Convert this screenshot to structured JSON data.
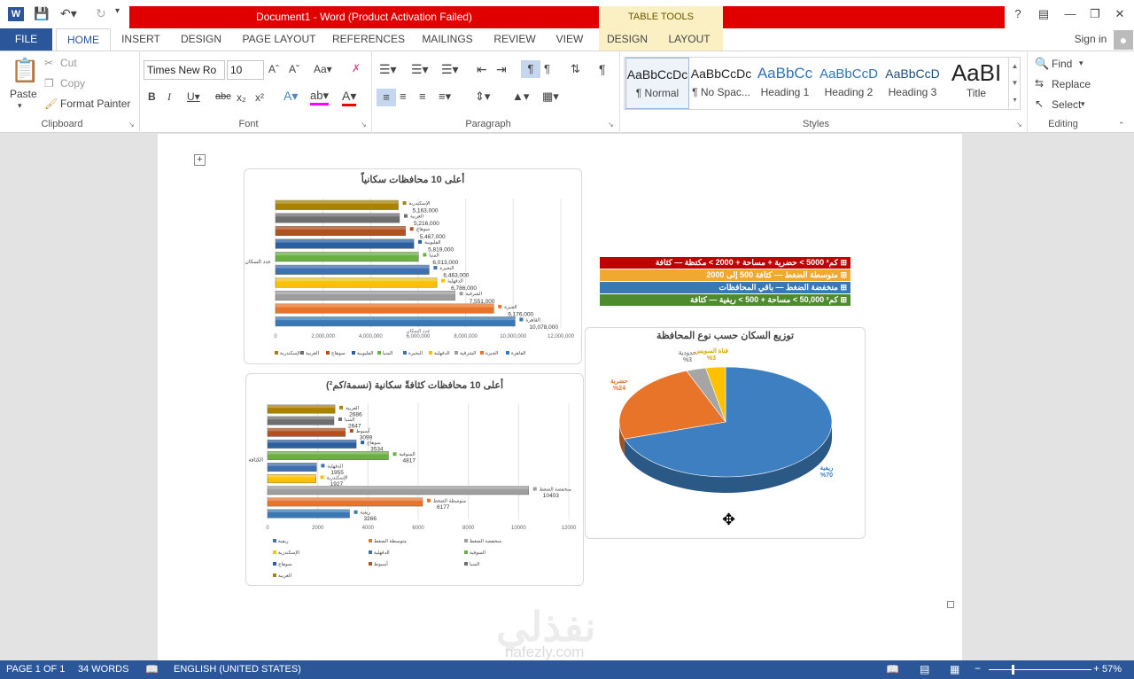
{
  "titlebar": {
    "doc_title": "Document1 -  Word (Product Activation Failed)",
    "table_tools": "TABLE TOOLS",
    "help": "?"
  },
  "tabs": {
    "file": "FILE",
    "home": "HOME",
    "insert": "INSERT",
    "design": "DESIGN",
    "page_layout": "PAGE LAYOUT",
    "references": "REFERENCES",
    "mailings": "MAILINGS",
    "review": "REVIEW",
    "view": "VIEW",
    "tt_design": "DESIGN",
    "tt_layout": "LAYOUT",
    "signin": "Sign in"
  },
  "clipboard": {
    "paste": "Paste",
    "cut": "Cut",
    "copy": "Copy",
    "format_painter": "Format Painter",
    "label": "Clipboard"
  },
  "font": {
    "name": "Times New Ro",
    "size": "10",
    "label": "Font"
  },
  "paragraph": {
    "label": "Paragraph"
  },
  "styles": {
    "items": [
      {
        "sample": "AaBbCcDc",
        "name": "¶ Normal"
      },
      {
        "sample": "AaBbCcDc",
        "name": "¶ No Spac..."
      },
      {
        "sample": "AaBbCc",
        "name": "Heading 1"
      },
      {
        "sample": "AaBbCcD",
        "name": "Heading 2"
      },
      {
        "sample": "AaBbCcD",
        "name": "Heading 3"
      },
      {
        "sample": "AaBI",
        "name": "Title"
      }
    ],
    "label": "Styles"
  },
  "editing": {
    "find": "Find",
    "replace": "Replace",
    "select": "Select",
    "label": "Editing"
  },
  "status": {
    "page": "PAGE 1 OF 1",
    "words": "34 WORDS",
    "language": "ENGLISH (UNITED STATES)",
    "zoom": "57%"
  },
  "legend_boxes": [
    {
      "text": "كم² 5000 > حضرية + مساحة + 2000 > مكتظة — كثافة ⊞",
      "color": "#c00000"
    },
    {
      "text": "متوسطة الضغط — كثافة 500 إلى 2000 ⊞",
      "color": "#f0a830"
    },
    {
      "text": "منخفضة الضغط — باقي المحافظات ⊞",
      "color": "#3a78b5"
    },
    {
      "text": "كم² 50,000 > مساحة + 500 > ريفية — كثافة ⊞",
      "color": "#4e8a2e"
    }
  ],
  "colors": {
    "accent": "#2b579a",
    "title_red": "#e00000"
  },
  "watermark": {
    "arabic": "نفذلي",
    "latin": "nafezly.com"
  },
  "chart_data": [
    {
      "type": "bar",
      "title": "أعلى 10 محافظات سكانياً",
      "ylabel": "عدد السكان",
      "xlabel": "عدد السكان",
      "categories": [
        "القاهرة",
        "الجيزة",
        "الشرقية",
        "الدقهلية",
        "البحيرة",
        "المنيا",
        "القليوبية",
        "سوهاج",
        "الغربية",
        "الإسكندرية"
      ],
      "values": [
        10078000,
        9176000,
        7551000,
        6786000,
        6463000,
        6013000,
        5819000,
        5467000,
        5216000,
        5163000
      ],
      "labels": [
        "10,078,000",
        "9,176,000",
        "7,551,000",
        "6,786,000",
        "6,463,000",
        "6,013,000",
        "5,819,000",
        "5,467,000",
        "5,216,000",
        "5,163,000"
      ],
      "colors": [
        "#3a78b5",
        "#e8742a",
        "#9e9e9e",
        "#ffc000",
        "#3e6fb0",
        "#6ab040",
        "#2a5fa0",
        "#b2501e",
        "#6e6e6e",
        "#a88200"
      ],
      "xlim": [
        0,
        12000000
      ],
      "xticks": [
        "0",
        "2,000,000",
        "4,000,000",
        "6,000,000",
        "8,000,000",
        "10,000,000",
        "12,000,000"
      ]
    },
    {
      "type": "bar",
      "title": "أعلى 10 محافظات كثافةً سكانية (نسمة/كم²)",
      "ylabel": "الكثافة",
      "categories": [
        "ريفية",
        "متوسطة الضغط",
        "منخفضة الضغط",
        "الإسكندرية",
        "الدقهلية",
        "المنوفية",
        "سوهاج",
        "أسيوط",
        "المنيا",
        "الغربية"
      ],
      "values": [
        3266,
        6177,
        10403,
        1927,
        1955,
        4817,
        3534,
        3099,
        2647,
        2686
      ],
      "labels": [
        "3266",
        "6177",
        "10403",
        "1927",
        "1955",
        "4817",
        "3534",
        "3099",
        "2647",
        "2686"
      ],
      "colors": [
        "#3a78b5",
        "#e8742a",
        "#9e9e9e",
        "#ffc000",
        "#3e6fb0",
        "#6ab040",
        "#2a5fa0",
        "#b2501e",
        "#6e6e6e",
        "#a88200"
      ],
      "xlim": [
        0,
        12000
      ],
      "xticks": [
        "0",
        "2000",
        "4000",
        "6000",
        "8000",
        "10000",
        "12000"
      ]
    },
    {
      "type": "pie",
      "title": "توزيع السكان حسب نوع المحافظة",
      "categories": [
        "ريفية",
        "حضرية",
        "حدودية",
        "قناة السويس"
      ],
      "values": [
        70,
        24,
        3,
        3
      ],
      "labels": [
        "ريفية %70",
        "حضرية %24",
        "حدودية %3",
        "قناة السويس %3"
      ],
      "colors": [
        "#3d7fc0",
        "#e8742a",
        "#a5a5a5",
        "#ffc000"
      ]
    }
  ]
}
